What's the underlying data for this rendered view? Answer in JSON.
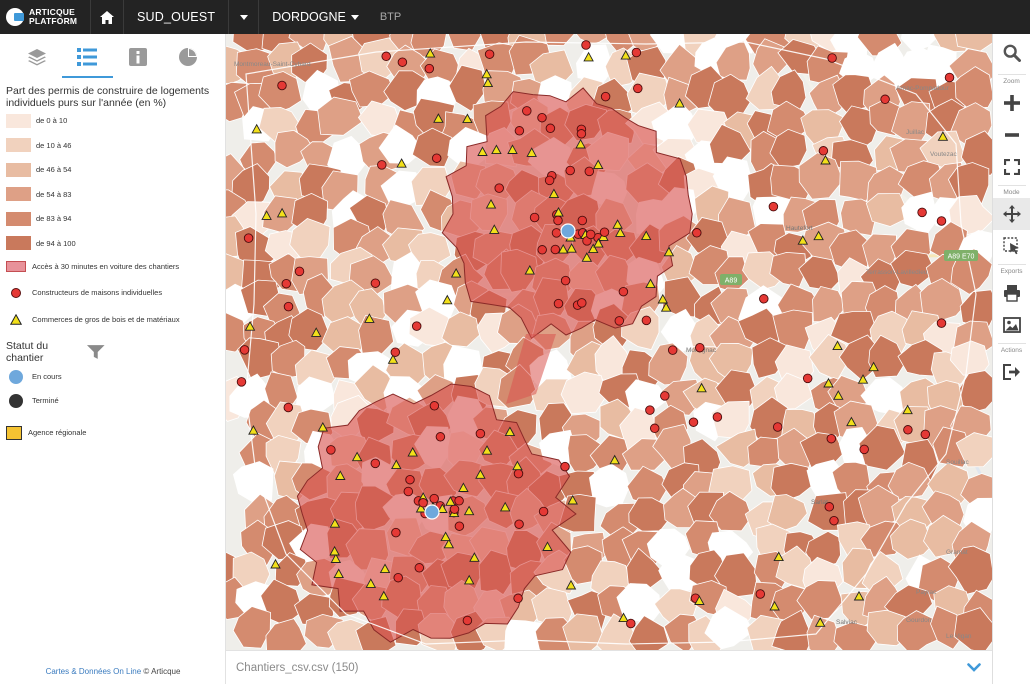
{
  "app": {
    "logo_line1": "ARTICQUE",
    "logo_line2": "PLATFORM",
    "region": "SUD_OUEST",
    "department": "DORDOGNE",
    "theme": "BTP",
    "accent": "#3f99d9"
  },
  "panel": {
    "tabs": [
      {
        "icon": "layers-icon",
        "active": false
      },
      {
        "icon": "legend-list-icon",
        "active": true
      },
      {
        "icon": "info-icon",
        "active": false
      },
      {
        "icon": "pie-chart-icon",
        "active": false
      }
    ],
    "legend_title": "Part des permis de construire de logements individuels purs sur l'année (en %)",
    "classes": [
      {
        "label": "de 0 à 10",
        "color": "#f9e7dc"
      },
      {
        "label": "de 10 à 46",
        "color": "#f1d2be"
      },
      {
        "label": "de 46 à 54",
        "color": "#e8bca2"
      },
      {
        "label": "de 54 à 83",
        "color": "#dea086"
      },
      {
        "label": "de 83 à 94",
        "color": "#d48b6f"
      },
      {
        "label": "de 94 à 100",
        "color": "#c9795c"
      }
    ],
    "zone_label": "Accès à 30 minutes en voiture des chantiers",
    "builders_label": "Constructeurs de maisons individuelles",
    "merchants_label": "Commerces de gros de bois et de matériaux",
    "status_title": "Statut du chantier",
    "status": [
      {
        "label": "En cours",
        "color": "#6fa8dc"
      },
      {
        "label": "Terminé",
        "color": "#333333"
      }
    ],
    "agency_label": "Agence régionale",
    "credit_link": "Cartes & Données On Line",
    "credit_rest": "© Articque"
  },
  "map": {
    "labels": [
      "Montmoreau-Saint-Cybard",
      "Arnac-Pompadour",
      "Juillac",
      "Voutezac",
      "Terrasson-Lavilledieu",
      "Souillac",
      "Le Vigan",
      "Gourdon",
      "Gramat",
      "Payrac",
      "Sarlat",
      "Salviac",
      "Montignac",
      "Hautefort"
    ],
    "road_labels": [
      "A89",
      "A89 E70"
    ]
  },
  "toolbar": {
    "zoom_label": "Zoom",
    "mode_label": "Mode",
    "exports_label": "Exports",
    "actions_label": "Actions"
  },
  "bottombar": {
    "dataset": "Chantiers_csv.csv (150)"
  }
}
